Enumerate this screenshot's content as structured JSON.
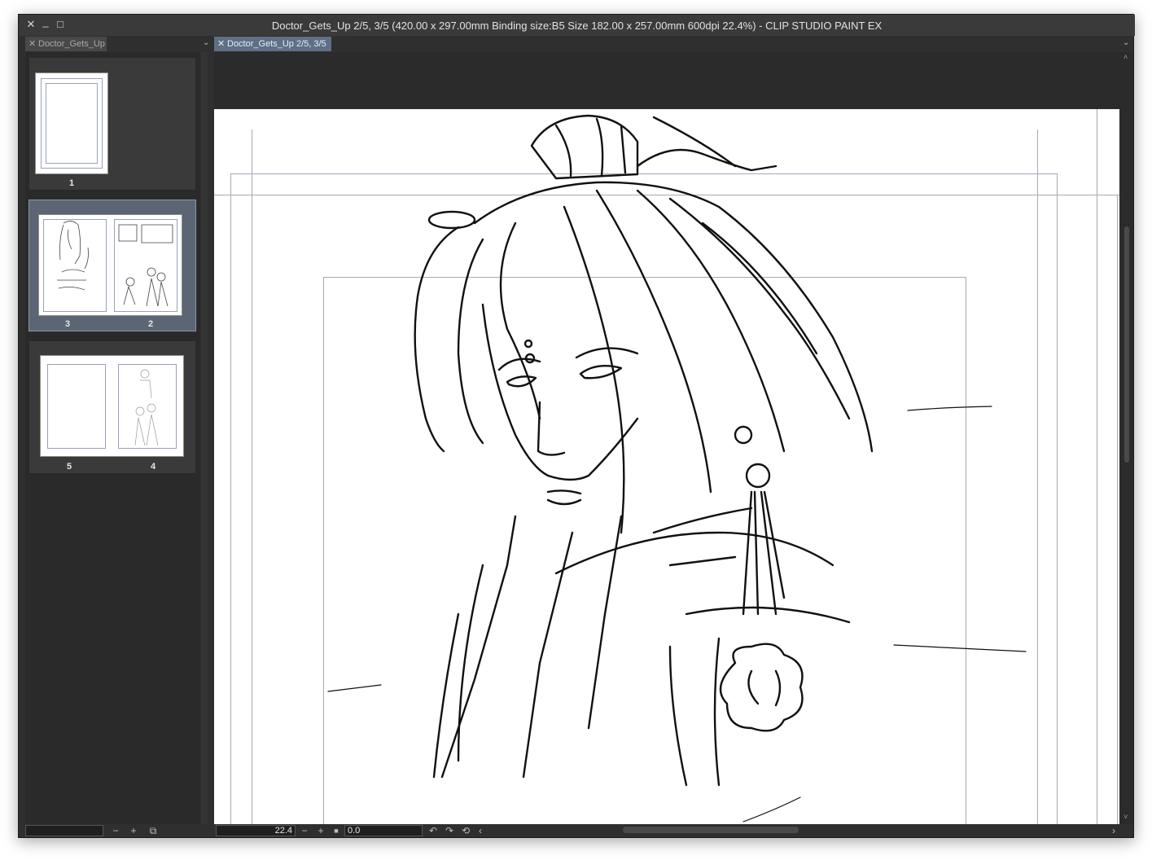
{
  "window": {
    "title": "Doctor_Gets_Up 2/5, 3/5 (420.00 x 297.00mm Binding size:B5 Size 182.00 x 257.00mm 600dpi 22.4%)  - CLIP STUDIO PAINT EX",
    "close_glyph": "✕",
    "minimize_glyph": "_",
    "maximize_glyph": "□"
  },
  "left_panel": {
    "tab_label": "Doctor_Gets_Up",
    "tab_close": "✕",
    "menu_glyph": "⌄",
    "pages": [
      {
        "labels": [
          "1"
        ],
        "selected": false
      },
      {
        "labels": [
          "3",
          "2"
        ],
        "selected": true
      },
      {
        "labels": [
          "5",
          "4"
        ],
        "selected": false
      }
    ],
    "footer": {
      "zoom_minus": "−",
      "zoom_plus": "+",
      "option_icon": "⧉"
    }
  },
  "canvas_tab": {
    "label": "Doctor_Gets_Up 2/5, 3/5",
    "close": "✕",
    "menu_glyph": "⌄"
  },
  "statusbar": {
    "zoom_value": "22.4",
    "zoom_minus": "−",
    "zoom_plus": "+",
    "fit_icon": "■",
    "rotation_value": "0.0",
    "undo_rotate": "↶",
    "redo_rotate": "↷",
    "reset_rotate": "⟲",
    "scroll_left": "‹",
    "scroll_right": "›"
  },
  "scrollbar": {
    "up": "˄",
    "down": "˅"
  },
  "colors": {
    "chrome": "#2f2f2f",
    "titlebar": "#3a3a3a",
    "tab_active": "#5e6f86",
    "selection": "#5c6574",
    "guide": "#a7a9b8",
    "ink": "#111111"
  }
}
